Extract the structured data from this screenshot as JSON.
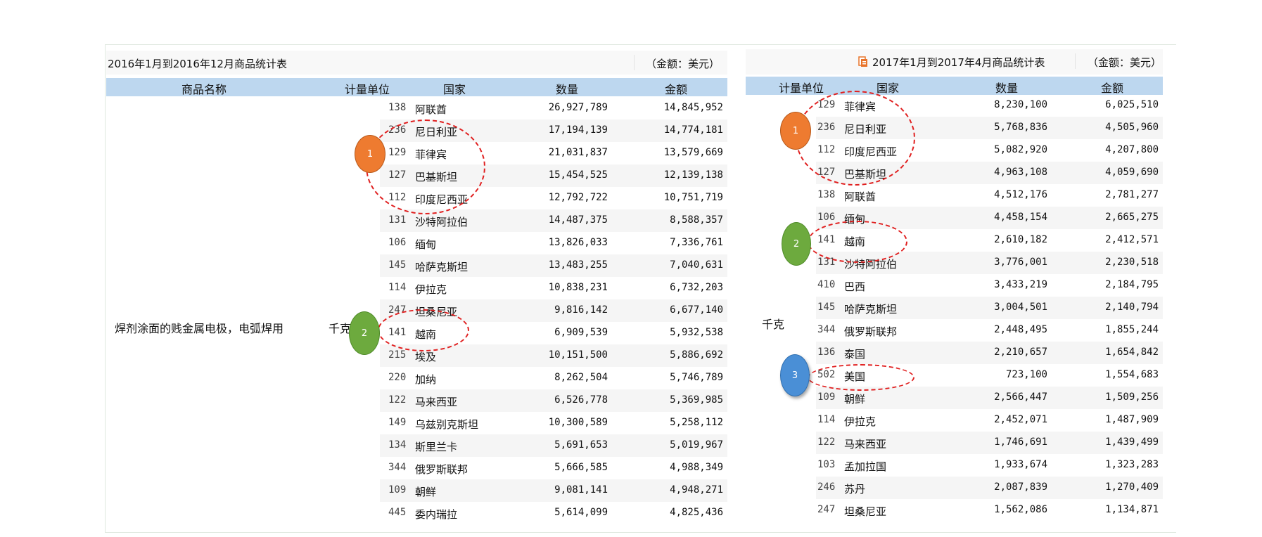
{
  "left_table": {
    "title": "2016年1月到2016年12月商品统计表",
    "unit_note": "（金额：美元）",
    "headers": {
      "product": "商品名称",
      "unit": "计量单位",
      "country": "国家",
      "quantity": "数量",
      "amount": "金额"
    },
    "product_name": "焊剂涂面的贱金属电极，电弧焊用",
    "unit_value": "千克",
    "rows": [
      {
        "code": "138",
        "country": "阿联酋",
        "quantity": "26,927,789",
        "amount": "14,845,952"
      },
      {
        "code": "236",
        "country": "尼日利亚",
        "quantity": "17,194,139",
        "amount": "14,774,181"
      },
      {
        "code": "129",
        "country": "菲律宾",
        "quantity": "21,031,837",
        "amount": "13,579,669"
      },
      {
        "code": "127",
        "country": "巴基斯坦",
        "quantity": "15,454,525",
        "amount": "12,139,138"
      },
      {
        "code": "112",
        "country": "印度尼西亚",
        "quantity": "12,792,722",
        "amount": "10,751,719"
      },
      {
        "code": "131",
        "country": "沙特阿拉伯",
        "quantity": "14,487,375",
        "amount": "8,588,357"
      },
      {
        "code": "106",
        "country": "缅甸",
        "quantity": "13,826,033",
        "amount": "7,336,761"
      },
      {
        "code": "145",
        "country": "哈萨克斯坦",
        "quantity": "13,483,255",
        "amount": "7,040,631"
      },
      {
        "code": "114",
        "country": "伊拉克",
        "quantity": "10,838,231",
        "amount": "6,732,203"
      },
      {
        "code": "247",
        "country": "坦桑尼亚",
        "quantity": "9,816,142",
        "amount": "6,677,140"
      },
      {
        "code": "141",
        "country": "越南",
        "quantity": "6,909,539",
        "amount": "5,932,538"
      },
      {
        "code": "215",
        "country": "埃及",
        "quantity": "10,151,500",
        "amount": "5,886,692"
      },
      {
        "code": "220",
        "country": "加纳",
        "quantity": "8,262,504",
        "amount": "5,746,789"
      },
      {
        "code": "122",
        "country": "马来西亚",
        "quantity": "6,526,778",
        "amount": "5,369,985"
      },
      {
        "code": "149",
        "country": "乌兹别克斯坦",
        "quantity": "10,300,589",
        "amount": "5,258,112"
      },
      {
        "code": "134",
        "country": "斯里兰卡",
        "quantity": "5,691,653",
        "amount": "5,019,967"
      },
      {
        "code": "344",
        "country": "俄罗斯联邦",
        "quantity": "5,666,585",
        "amount": "4,988,349"
      },
      {
        "code": "109",
        "country": "朝鲜",
        "quantity": "9,081,141",
        "amount": "4,948,271"
      },
      {
        "code": "445",
        "country": "委内瑞拉",
        "quantity": "5,614,099",
        "amount": "4,825,436"
      }
    ]
  },
  "right_table": {
    "title": "2017年1月到2017年4月商品统计表",
    "unit_note": "（金额：美元）",
    "title_icon": "document-icon",
    "headers": {
      "unit": "计量单位",
      "country": "国家",
      "quantity": "数量",
      "amount": "金额"
    },
    "unit_value": "千克",
    "rows": [
      {
        "code": "129",
        "country": "菲律宾",
        "quantity": "8,230,100",
        "amount": "6,025,510"
      },
      {
        "code": "236",
        "country": "尼日利亚",
        "quantity": "5,768,836",
        "amount": "4,505,960"
      },
      {
        "code": "112",
        "country": "印度尼西亚",
        "quantity": "5,082,920",
        "amount": "4,207,800"
      },
      {
        "code": "127",
        "country": "巴基斯坦",
        "quantity": "4,963,108",
        "amount": "4,059,690"
      },
      {
        "code": "138",
        "country": "阿联酋",
        "quantity": "4,512,176",
        "amount": "2,781,277"
      },
      {
        "code": "106",
        "country": "缅甸",
        "quantity": "4,458,154",
        "amount": "2,665,275"
      },
      {
        "code": "141",
        "country": "越南",
        "quantity": "2,610,182",
        "amount": "2,412,571"
      },
      {
        "code": "131",
        "country": "沙特阿拉伯",
        "quantity": "3,776,001",
        "amount": "2,230,518"
      },
      {
        "code": "410",
        "country": "巴西",
        "quantity": "3,433,219",
        "amount": "2,184,795"
      },
      {
        "code": "145",
        "country": "哈萨克斯坦",
        "quantity": "3,004,501",
        "amount": "2,140,794"
      },
      {
        "code": "344",
        "country": "俄罗斯联邦",
        "quantity": "2,448,495",
        "amount": "1,855,244"
      },
      {
        "code": "136",
        "country": "泰国",
        "quantity": "2,210,657",
        "amount": "1,654,842"
      },
      {
        "code": "502",
        "country": "美国",
        "quantity": "723,100",
        "amount": "1,554,683"
      },
      {
        "code": "109",
        "country": "朝鲜",
        "quantity": "2,566,447",
        "amount": "1,509,256"
      },
      {
        "code": "114",
        "country": "伊拉克",
        "quantity": "2,452,071",
        "amount": "1,487,909"
      },
      {
        "code": "122",
        "country": "马来西亚",
        "quantity": "1,746,691",
        "amount": "1,439,499"
      },
      {
        "code": "103",
        "country": "孟加拉国",
        "quantity": "1,933,674",
        "amount": "1,323,283"
      },
      {
        "code": "246",
        "country": "苏丹",
        "quantity": "2,087,839",
        "amount": "1,270,409"
      },
      {
        "code": "247",
        "country": "坦桑尼亚",
        "quantity": "1,562,086",
        "amount": "1,134,871"
      }
    ]
  },
  "markers": [
    {
      "label": "1",
      "color": "#ee7b30"
    },
    {
      "label": "2",
      "color": "#6daa3e"
    },
    {
      "label": "1",
      "color": "#ee7b30"
    },
    {
      "label": "2",
      "color": "#6daa3e"
    },
    {
      "label": "3",
      "color": "#4a8fd6"
    }
  ]
}
